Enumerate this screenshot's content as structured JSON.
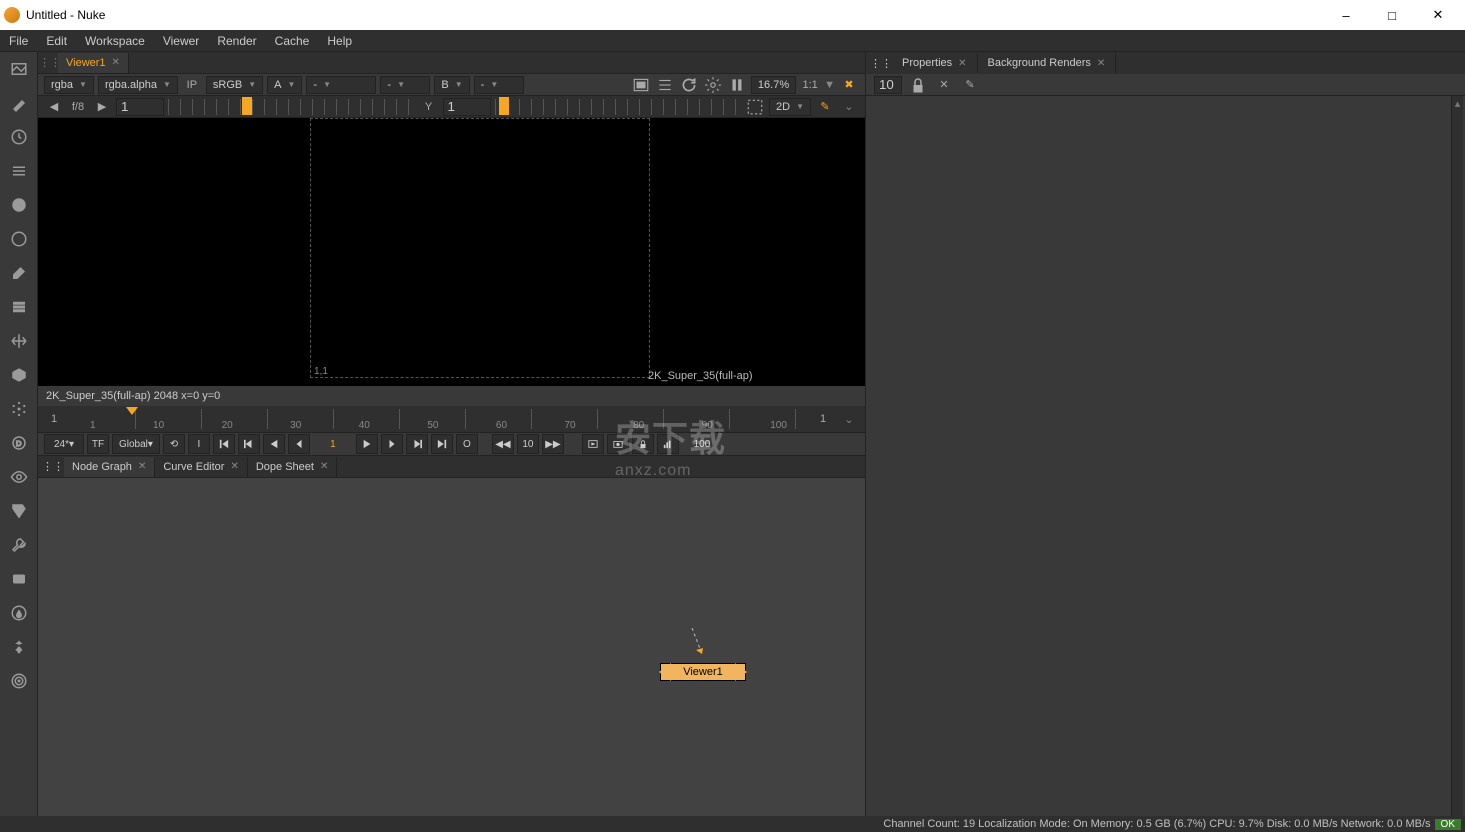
{
  "window": {
    "title": "Untitled - Nuke"
  },
  "menus": [
    "File",
    "Edit",
    "Workspace",
    "Viewer",
    "Render",
    "Cache",
    "Help"
  ],
  "viewer": {
    "tab": "Viewer1",
    "channel": "rgba",
    "alpha": "rgba.alpha",
    "ip": "IP",
    "lut": "sRGB",
    "inputA": "A",
    "dashA": "-",
    "dashB": "-",
    "inputB": "B",
    "dashC": "-",
    "zoom": "16.7%",
    "ratio": "1:1",
    "fstop": "f/8",
    "step_l": "1",
    "ylabel": "Y",
    "yval": "1",
    "mode2d": "2D",
    "format_label": "2K_Super_35(full-ap)",
    "corner": "1,1",
    "status": "2K_Super_35(full-ap) 2048  x=0 y=0"
  },
  "timeline": {
    "frame_left": "1",
    "frame_right": "1",
    "ticks": [
      "1",
      "10",
      "20",
      "30",
      "40",
      "50",
      "60",
      "70",
      "80",
      "90",
      "100"
    ]
  },
  "playbar": {
    "fps": "24*",
    "tf": "TF",
    "range": "Global",
    "i": "I",
    "cur": "1",
    "o": "O",
    "skip": "10",
    "end": "100"
  },
  "lower_tabs": [
    "Node Graph",
    "Curve Editor",
    "Dope Sheet"
  ],
  "node_name": "Viewer1",
  "right": {
    "tabs": [
      "Properties",
      "Background Renders"
    ],
    "count": "10"
  },
  "status": {
    "text": "Channel Count: 19 Localization Mode: On Memory: 0.5 GB (6.7%) CPU: 9.7% Disk: 0.0 MB/s Network: 0.0 MB/s",
    "ok": "OK"
  },
  "watermark": {
    "cn": "安下载",
    "en": "anxz.com"
  }
}
